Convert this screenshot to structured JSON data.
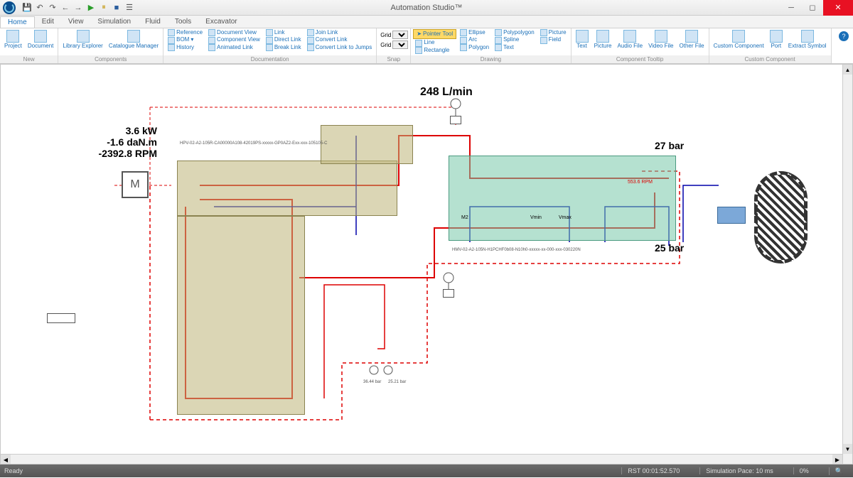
{
  "app": {
    "title": "Automation Studio™"
  },
  "qat": {
    "save": "💾",
    "undo": "↶",
    "redo": "↷",
    "back": "←",
    "fwd": "→",
    "sim_play": "▶",
    "sim_pause": "⏸",
    "sim_stop": "■",
    "menu": "☰"
  },
  "menu": {
    "tabs": [
      "Home",
      "Edit",
      "View",
      "Simulation",
      "Fluid",
      "Tools",
      "Excavator"
    ],
    "active": 0
  },
  "ribbon": {
    "groups": {
      "new": {
        "label": "New",
        "project": "Project",
        "document": "Document"
      },
      "components": {
        "label": "Components",
        "library": "Library Explorer",
        "catalogue": "Catalogue Manager"
      },
      "documentation": {
        "label": "Documentation",
        "reference": "Reference",
        "doc_view": "Document View",
        "link": "Link",
        "join_link": "Join Link",
        "bom": "BOM",
        "comp_view": "Component View",
        "direct_link": "Direct Link",
        "convert_link": "Convert Link",
        "history": "History",
        "anim_link": "Animated Link",
        "break_link": "Break Link",
        "convert_jumps": "Convert Link to Jumps"
      },
      "snap": {
        "label": "Snap",
        "grid": "Grid"
      },
      "drawing": {
        "label": "Drawing",
        "pointer": "Pointer Tool",
        "ellipse": "Ellipse",
        "polypolygon": "Polypolygon",
        "picture": "Picture",
        "line": "Line",
        "arc": "Arc",
        "spline": "Spline",
        "field": "Field",
        "rectangle": "Rectangle",
        "polygon": "Polygon",
        "text": "Text"
      },
      "tooltip": {
        "label": "Component Tooltip",
        "text": "Text",
        "picture": "Picture",
        "audio": "Audio File",
        "video": "Video File",
        "other": "Other File"
      },
      "custom": {
        "label": "Custom Component",
        "custom": "Custom Component",
        "port": "Port",
        "extract": "Extract Symbol"
      }
    }
  },
  "schematic": {
    "flow_label": "248 L/min",
    "motor_power": "3.6 kW",
    "motor_torque": "-1.6 daN.m",
    "motor_speed": "-2392.8 RPM",
    "pump_partno": "HPV-02-A2-105R-CA00000A108-42019PS-xxxxx-GP0AZ2-Exx-xxx-105105-C",
    "motor_partno": "HMV-02-A2-105N-H1PCHF0b08-N10h0-xxxxx-xx-000-xxx-030220N",
    "p_charge": "27 bar",
    "p_case": "25 bar",
    "motor_speed_small": "553.6 RPM",
    "vmin": "Vmin",
    "vmax": "Vmax",
    "m2": "M2",
    "gauge1": "36.44 bar",
    "gauge2": "25.21 bar",
    "motor_symbol": "M"
  },
  "status": {
    "ready": "Ready",
    "rst": "RST 00:01:52.570",
    "pace": "Simulation Pace: 10 ms",
    "pct": "0%"
  }
}
